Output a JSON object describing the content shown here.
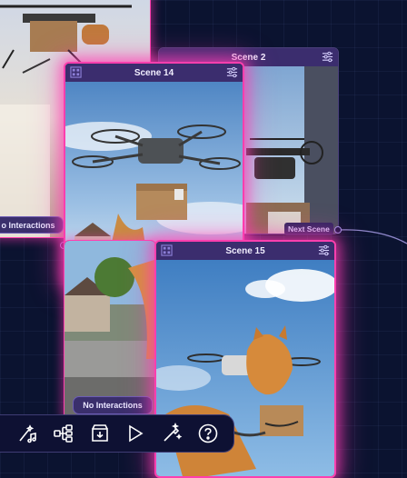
{
  "scenes": {
    "scene_2": {
      "title": "Scene 2"
    },
    "scene_14": {
      "title": "Scene 14"
    },
    "scene_15": {
      "title": "Scene 15"
    }
  },
  "pills": {
    "left_no_interactions": "o Interactions",
    "scene14_no_interactions": "No Interactions"
  },
  "connector": {
    "next_scene_label": "Next Scene"
  },
  "toolbar": {
    "tools": [
      "magic-music-icon",
      "network-icon",
      "download-box-icon",
      "play-icon",
      "magic-wand-icon",
      "help-icon"
    ]
  },
  "colors": {
    "selected_glow": "#ff3fae",
    "header_bg": "#3b2d6e",
    "canvas_bg": "#0b1330"
  }
}
